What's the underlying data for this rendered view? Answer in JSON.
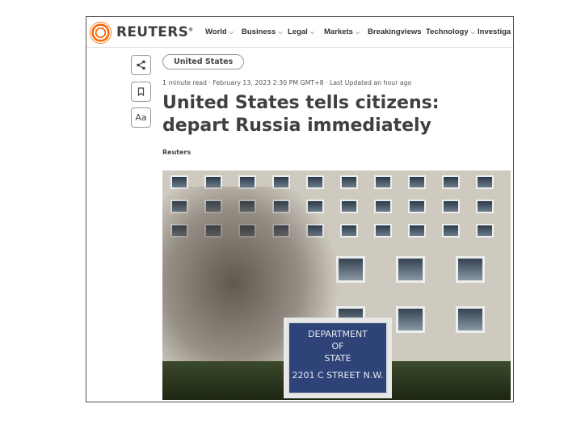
{
  "brand": {
    "name": "REUTERS",
    "registered": "®",
    "color": "#fa6400"
  },
  "nav": [
    {
      "label": "World",
      "dropdown": true
    },
    {
      "label": "Business",
      "dropdown": true
    },
    {
      "label": "Legal",
      "dropdown": true
    },
    {
      "label": "Markets",
      "dropdown": true
    },
    {
      "label": "Breakingviews",
      "dropdown": false
    },
    {
      "label": "Technology",
      "dropdown": true
    },
    {
      "label": "Investiga",
      "dropdown": false
    }
  ],
  "tools": {
    "share_icon": "share-icon",
    "bookmark_icon": "bookmark-icon",
    "font_label": "Aa"
  },
  "article": {
    "tag": "United States",
    "meta": "1 minute read · February 13, 2023 2:30 PM GMT+8 · Last Updated an hour ago",
    "title": "United States tells citizens: depart Russia immediately",
    "byline": "Reuters"
  },
  "photo": {
    "sign_lines": [
      "DEPARTMENT",
      "OF",
      "STATE",
      "2201 C STREET N.W."
    ]
  }
}
